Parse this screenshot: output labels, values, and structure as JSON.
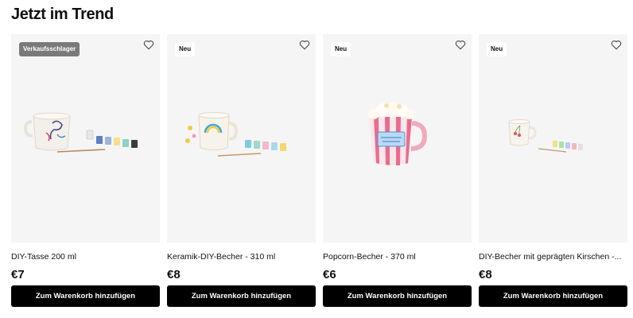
{
  "section": {
    "title": "Jetzt im Trend"
  },
  "colors": {
    "button_bg": "#000000",
    "button_text": "#ffffff",
    "card_bg": "#f5f5f5",
    "badge_bestseller_bg": "#7a7a7a"
  },
  "icons": {
    "favorite": "heart-outline-icon"
  },
  "products": [
    {
      "badge": "Verkaufsschlager",
      "name": "DIY-Tasse 200 ml",
      "price": "€7",
      "button": "Zum Warenkorb hinzufügen"
    },
    {
      "badge": "Neu",
      "name": "Keramik-DIY-Becher - 310 ml",
      "price": "€8",
      "button": "Zum Warenkorb hinzufügen"
    },
    {
      "badge": "Neu",
      "name": "Popcorn-Becher - 370 ml",
      "price": "€6",
      "button": "Zum Warenkorb hinzufügen"
    },
    {
      "badge": "Neu",
      "name": "DIY-Becher mit geprägten Kirschen -...",
      "price": "€8",
      "button": "Zum Warenkorb hinzufügen"
    }
  ]
}
